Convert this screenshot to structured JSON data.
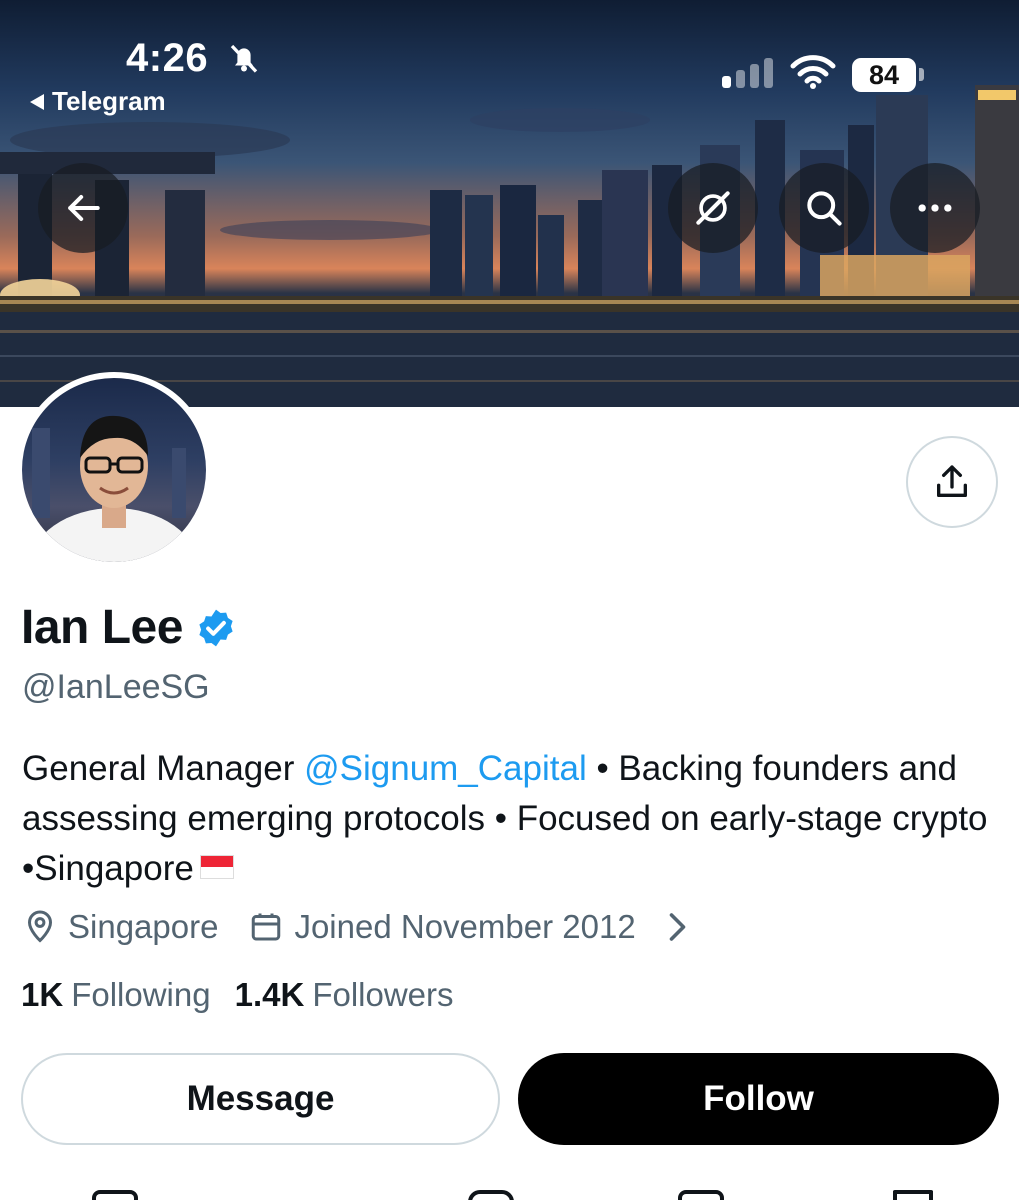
{
  "status_bar": {
    "time": "4:26",
    "back_app": "Telegram",
    "battery": "84",
    "icons": [
      "bell-slash-icon",
      "signal-icon",
      "wifi-icon",
      "battery-icon"
    ]
  },
  "header": {
    "back_icon": "arrow-left-icon",
    "grok_icon": "grok-icon",
    "search_icon": "search-icon",
    "more_icon": "more-horizontal-icon",
    "share_icon": "share-icon"
  },
  "profile": {
    "display_name": "Ian Lee",
    "verified_icon": "verified-badge-icon",
    "handle": "@IanLeeSG",
    "bio": {
      "prefix": "General Manager ",
      "mention": "@Signum_Capital",
      "suffix": " • Backing founders and assessing emerging protocols • Focused on early-stage crypto •Singapore"
    },
    "flag_icon": "singapore-flag-icon",
    "location": "Singapore",
    "joined": "Joined November 2012",
    "following_count": "1K",
    "following_label": "Following",
    "followers_count": "1.4K",
    "followers_label": "Followers"
  },
  "actions": {
    "message_label": "Message",
    "follow_label": "Follow"
  },
  "colors": {
    "accent": "#1d9bf0",
    "text_primary": "#0f1419",
    "text_secondary": "#536471",
    "follow_bg": "#000000"
  }
}
